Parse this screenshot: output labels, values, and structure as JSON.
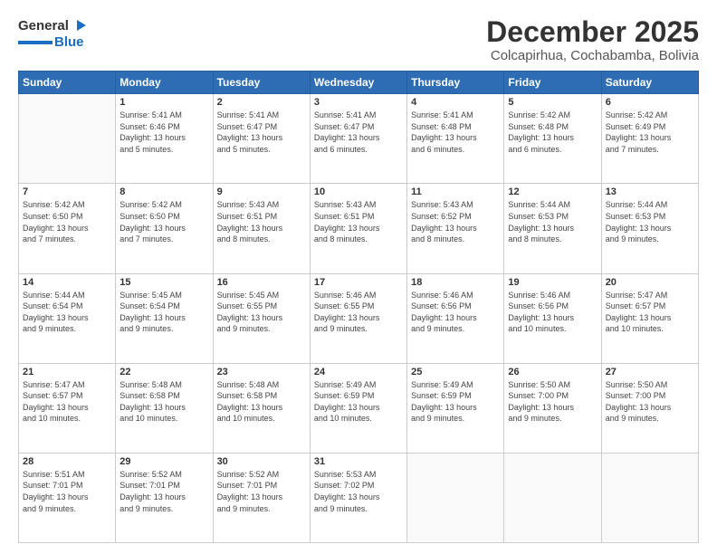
{
  "header": {
    "logo_general": "General",
    "logo_blue": "Blue",
    "title": "December 2025",
    "subtitle": "Colcapirhua, Cochabamba, Bolivia"
  },
  "weekdays": [
    "Sunday",
    "Monday",
    "Tuesday",
    "Wednesday",
    "Thursday",
    "Friday",
    "Saturday"
  ],
  "weeks": [
    [
      {
        "day": "",
        "info": ""
      },
      {
        "day": "1",
        "info": "Sunrise: 5:41 AM\nSunset: 6:46 PM\nDaylight: 13 hours\nand 5 minutes."
      },
      {
        "day": "2",
        "info": "Sunrise: 5:41 AM\nSunset: 6:47 PM\nDaylight: 13 hours\nand 5 minutes."
      },
      {
        "day": "3",
        "info": "Sunrise: 5:41 AM\nSunset: 6:47 PM\nDaylight: 13 hours\nand 6 minutes."
      },
      {
        "day": "4",
        "info": "Sunrise: 5:41 AM\nSunset: 6:48 PM\nDaylight: 13 hours\nand 6 minutes."
      },
      {
        "day": "5",
        "info": "Sunrise: 5:42 AM\nSunset: 6:48 PM\nDaylight: 13 hours\nand 6 minutes."
      },
      {
        "day": "6",
        "info": "Sunrise: 5:42 AM\nSunset: 6:49 PM\nDaylight: 13 hours\nand 7 minutes."
      }
    ],
    [
      {
        "day": "7",
        "info": "Sunrise: 5:42 AM\nSunset: 6:50 PM\nDaylight: 13 hours\nand 7 minutes."
      },
      {
        "day": "8",
        "info": "Sunrise: 5:42 AM\nSunset: 6:50 PM\nDaylight: 13 hours\nand 7 minutes."
      },
      {
        "day": "9",
        "info": "Sunrise: 5:43 AM\nSunset: 6:51 PM\nDaylight: 13 hours\nand 8 minutes."
      },
      {
        "day": "10",
        "info": "Sunrise: 5:43 AM\nSunset: 6:51 PM\nDaylight: 13 hours\nand 8 minutes."
      },
      {
        "day": "11",
        "info": "Sunrise: 5:43 AM\nSunset: 6:52 PM\nDaylight: 13 hours\nand 8 minutes."
      },
      {
        "day": "12",
        "info": "Sunrise: 5:44 AM\nSunset: 6:53 PM\nDaylight: 13 hours\nand 8 minutes."
      },
      {
        "day": "13",
        "info": "Sunrise: 5:44 AM\nSunset: 6:53 PM\nDaylight: 13 hours\nand 9 minutes."
      }
    ],
    [
      {
        "day": "14",
        "info": "Sunrise: 5:44 AM\nSunset: 6:54 PM\nDaylight: 13 hours\nand 9 minutes."
      },
      {
        "day": "15",
        "info": "Sunrise: 5:45 AM\nSunset: 6:54 PM\nDaylight: 13 hours\nand 9 minutes."
      },
      {
        "day": "16",
        "info": "Sunrise: 5:45 AM\nSunset: 6:55 PM\nDaylight: 13 hours\nand 9 minutes."
      },
      {
        "day": "17",
        "info": "Sunrise: 5:46 AM\nSunset: 6:55 PM\nDaylight: 13 hours\nand 9 minutes."
      },
      {
        "day": "18",
        "info": "Sunrise: 5:46 AM\nSunset: 6:56 PM\nDaylight: 13 hours\nand 9 minutes."
      },
      {
        "day": "19",
        "info": "Sunrise: 5:46 AM\nSunset: 6:56 PM\nDaylight: 13 hours\nand 10 minutes."
      },
      {
        "day": "20",
        "info": "Sunrise: 5:47 AM\nSunset: 6:57 PM\nDaylight: 13 hours\nand 10 minutes."
      }
    ],
    [
      {
        "day": "21",
        "info": "Sunrise: 5:47 AM\nSunset: 6:57 PM\nDaylight: 13 hours\nand 10 minutes."
      },
      {
        "day": "22",
        "info": "Sunrise: 5:48 AM\nSunset: 6:58 PM\nDaylight: 13 hours\nand 10 minutes."
      },
      {
        "day": "23",
        "info": "Sunrise: 5:48 AM\nSunset: 6:58 PM\nDaylight: 13 hours\nand 10 minutes."
      },
      {
        "day": "24",
        "info": "Sunrise: 5:49 AM\nSunset: 6:59 PM\nDaylight: 13 hours\nand 10 minutes."
      },
      {
        "day": "25",
        "info": "Sunrise: 5:49 AM\nSunset: 6:59 PM\nDaylight: 13 hours\nand 9 minutes."
      },
      {
        "day": "26",
        "info": "Sunrise: 5:50 AM\nSunset: 7:00 PM\nDaylight: 13 hours\nand 9 minutes."
      },
      {
        "day": "27",
        "info": "Sunrise: 5:50 AM\nSunset: 7:00 PM\nDaylight: 13 hours\nand 9 minutes."
      }
    ],
    [
      {
        "day": "28",
        "info": "Sunrise: 5:51 AM\nSunset: 7:01 PM\nDaylight: 13 hours\nand 9 minutes."
      },
      {
        "day": "29",
        "info": "Sunrise: 5:52 AM\nSunset: 7:01 PM\nDaylight: 13 hours\nand 9 minutes."
      },
      {
        "day": "30",
        "info": "Sunrise: 5:52 AM\nSunset: 7:01 PM\nDaylight: 13 hours\nand 9 minutes."
      },
      {
        "day": "31",
        "info": "Sunrise: 5:53 AM\nSunset: 7:02 PM\nDaylight: 13 hours\nand 9 minutes."
      },
      {
        "day": "",
        "info": ""
      },
      {
        "day": "",
        "info": ""
      },
      {
        "day": "",
        "info": ""
      }
    ]
  ]
}
